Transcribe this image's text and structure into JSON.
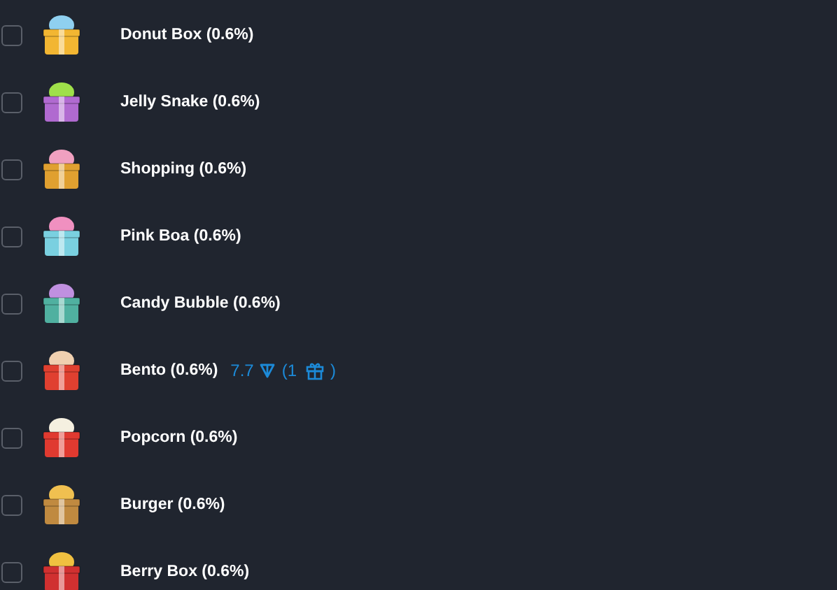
{
  "items": [
    {
      "label": "Donut Box (0.6%)",
      "checked": false
    },
    {
      "label": "Jelly Snake (0.6%)",
      "checked": false
    },
    {
      "label": "Shopping (0.6%)",
      "checked": false
    },
    {
      "label": "Pink Boa (0.6%)",
      "checked": false
    },
    {
      "label": "Candy Bubble (0.6%)",
      "checked": false
    },
    {
      "label": "Bento (0.6%)",
      "checked": false,
      "price": {
        "amount": "7.7",
        "count_open": "(1",
        "count_close": ")"
      }
    },
    {
      "label": "Popcorn (0.6%)",
      "checked": false
    },
    {
      "label": "Burger (0.6%)",
      "checked": false
    },
    {
      "label": "Berry Box (0.6%)",
      "checked": false
    }
  ]
}
